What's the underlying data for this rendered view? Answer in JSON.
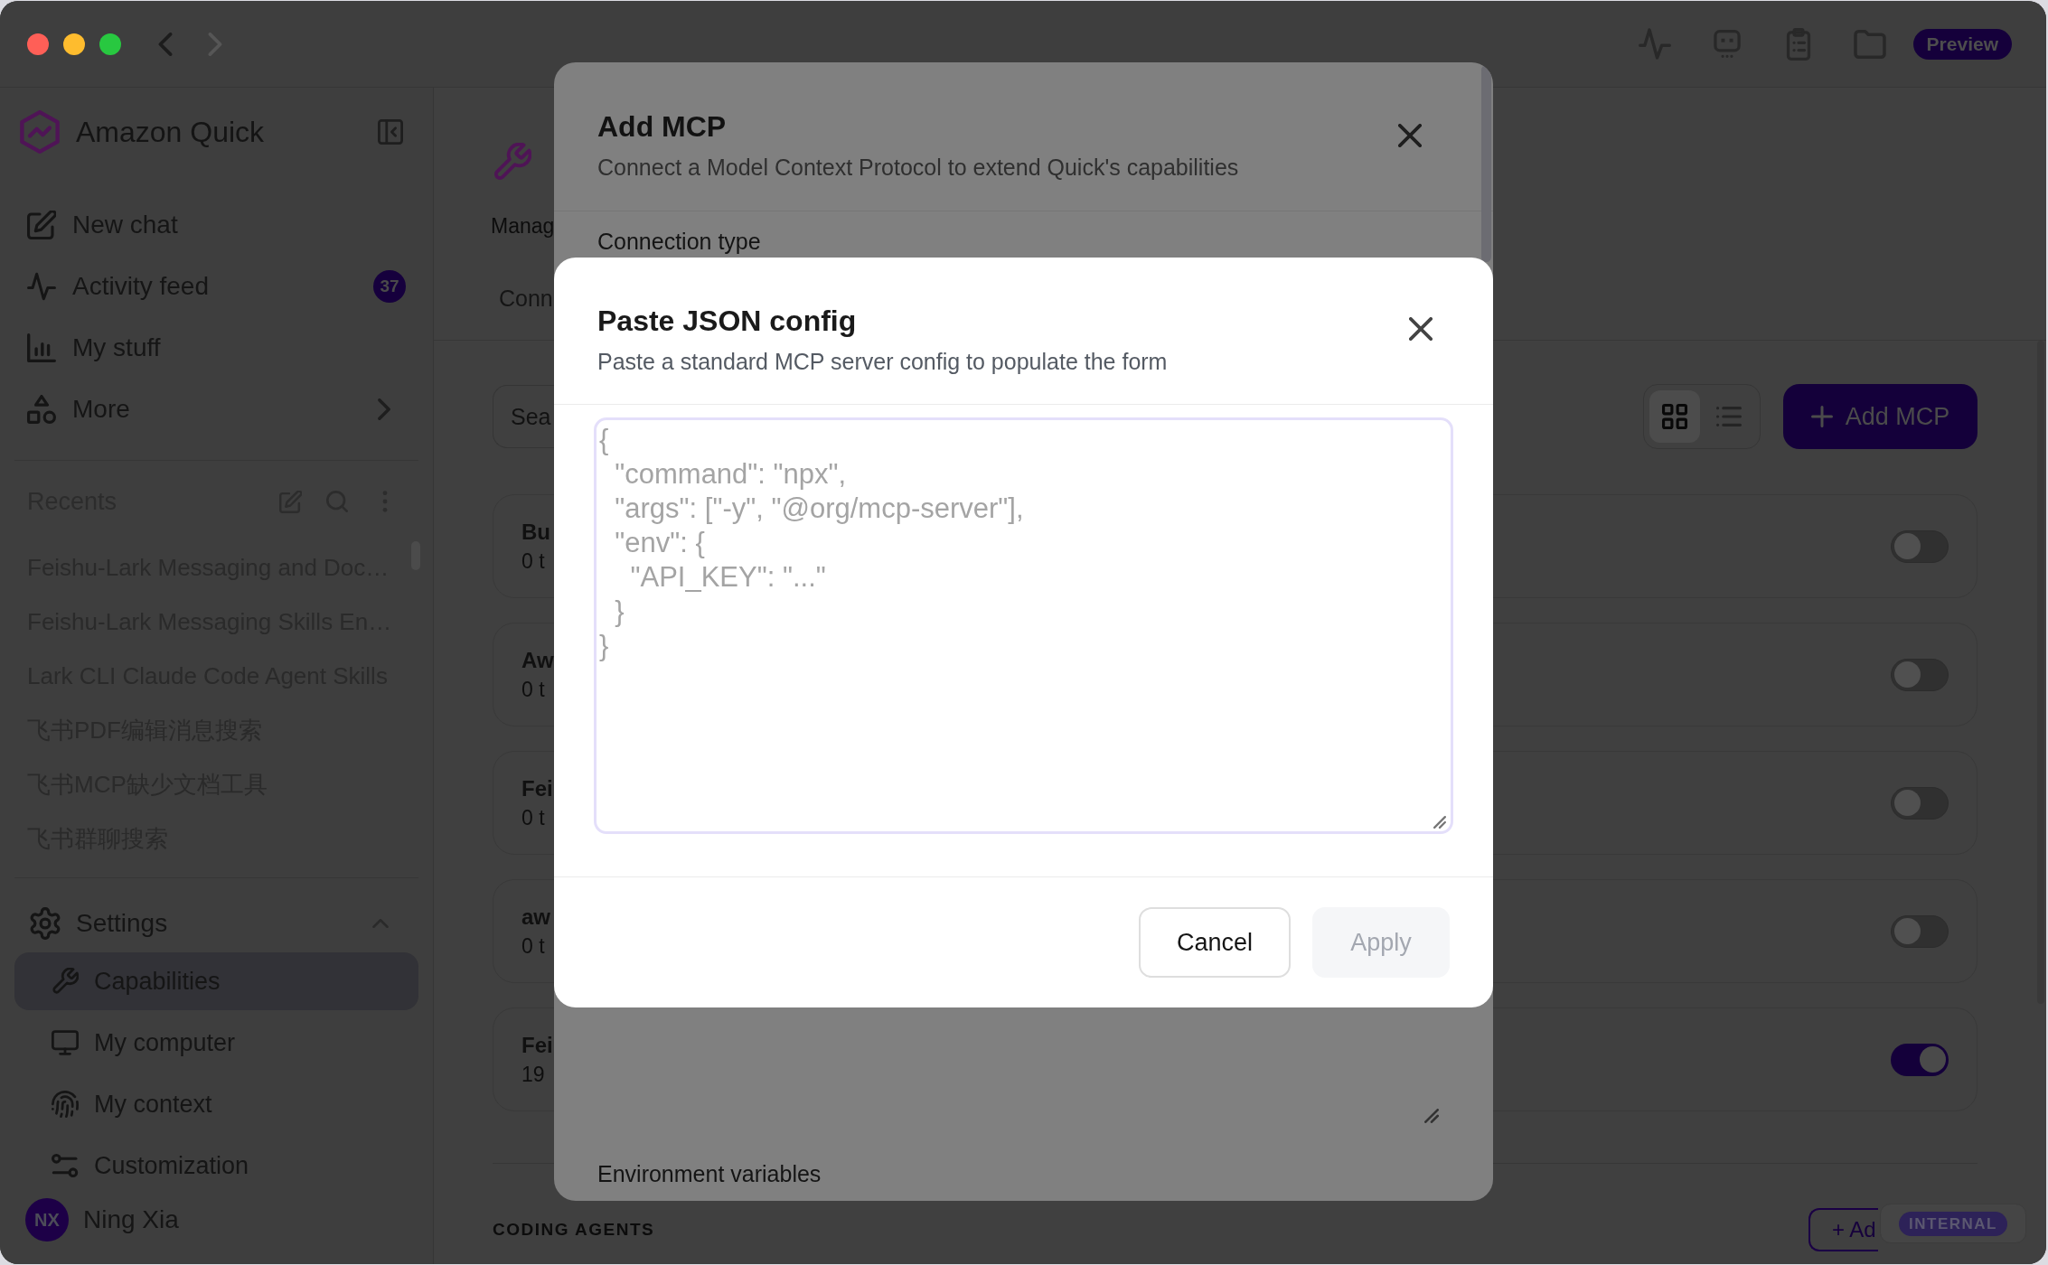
{
  "toolbar": {
    "history_buttons": [
      {
        "disabled": false
      },
      {
        "disabled": true
      }
    ],
    "preview_badge": "Preview"
  },
  "sidebar": {
    "app_name": "Amazon Quick",
    "nav": [
      {
        "label": "New chat",
        "selected": false,
        "expandable": false
      },
      {
        "label": "Activity feed",
        "count": "37",
        "selected": false,
        "expandable": false
      },
      {
        "label": "My stuff",
        "selected": false,
        "expandable": false
      },
      {
        "label": "More",
        "selected": false,
        "expandable": true
      }
    ],
    "recents": {
      "title": "Recents",
      "items": [
        "Feishu-Lark Messaging and Doc…",
        "Feishu-Lark Messaging Skills En…",
        "Lark CLI Claude Code Agent Skills",
        "飞书PDF编辑消息搜索",
        "飞书MCP缺少文档工具",
        "飞书群聊搜索"
      ]
    },
    "settings": {
      "label": "Settings",
      "expanded": true,
      "items": [
        {
          "label": "Capabilities",
          "selected": true
        },
        {
          "label": "My computer",
          "selected": false
        },
        {
          "label": "My context",
          "selected": false
        },
        {
          "label": "Customization",
          "selected": false
        }
      ]
    },
    "user": {
      "initials": "NX",
      "name": "Ning Xia"
    }
  },
  "main": {
    "header": {
      "description": "Manag",
      "section_label": "Conn"
    },
    "search": {
      "placeholder": "Sea"
    },
    "view_toggle": [
      {
        "kind": "grid",
        "selected": true
      },
      {
        "kind": "list",
        "selected": false
      }
    ],
    "add_button": "Add MCP",
    "servers": [
      {
        "name": "Bu",
        "detail": "0 t",
        "on": false
      },
      {
        "name": "Aw",
        "detail": "0 t",
        "on": false
      },
      {
        "name": "Fei",
        "detail": "0 t",
        "on": false
      },
      {
        "name": "aw",
        "detail": "0 t",
        "on": false
      },
      {
        "name": "Fei",
        "detail": "19",
        "on": true
      }
    ],
    "section_heading": "CODING AGENTS",
    "add_agent_button": "+ Ad",
    "environment_badge": "INTERNAL"
  },
  "add_mcp_dialog": {
    "title": "Add MCP",
    "subtitle": "Connect a Model Context Protocol to extend Quick's capabilities",
    "labels": [
      "Connection type",
      "Environment variables"
    ]
  },
  "paste_json_dialog": {
    "title": "Paste JSON config",
    "subtitle": "Paste a standard MCP server config to populate the form",
    "placeholder": "{\n  \"command\": \"npx\",\n  \"args\": [\"-y\", \"@org/mcp-server\"],\n  \"env\": {\n    \"API_KEY\": \"...\"\n  }\n}",
    "buttons": [
      {
        "label": "Cancel",
        "disabled": false
      },
      {
        "label": "Apply",
        "disabled": true
      }
    ]
  }
}
